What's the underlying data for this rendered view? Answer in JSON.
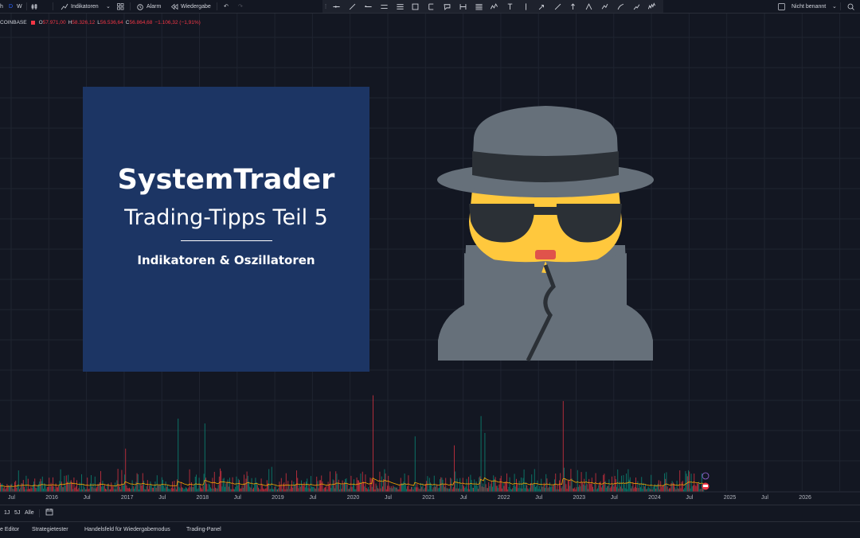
{
  "toolbar": {
    "interval_h": "h",
    "interval_d": "D",
    "interval_w": "W",
    "indicators_label": "Indikatoren",
    "alarm_label": "Alarm",
    "replay_label": "Wiedergabe",
    "layout_name": "Nicht benannt"
  },
  "drawing_tools": [
    "horizontal-line-icon",
    "trend-line-icon",
    "ray-icon",
    "parallel-channel-icon",
    "regression-channel-icon",
    "rectangle-icon",
    "date-range-icon",
    "callout-icon",
    "price-range-icon",
    "fib-retracement-icon",
    "path-icon",
    "text-icon",
    "vertical-line-icon",
    "long-position-icon",
    "arrow-marker-icon",
    "arrow-up-icon",
    "pitchfork-icon",
    "forecast-icon",
    "brush-icon",
    "projection-icon",
    "elliott-wave-icon"
  ],
  "legend": {
    "symbol": "COINBASE",
    "o_label": "O",
    "o_value": "57.971,00",
    "h_label": "H",
    "h_value": "58.326,12",
    "l_label": "L",
    "l_value": "56.536,64",
    "c_label": "C",
    "c_value": "56.864,68",
    "change": "−1.106,32 (−1,91%)"
  },
  "card": {
    "title": "SystemTrader",
    "subtitle": "Trading-Tipps Teil 5",
    "topic": "Indikatoren & Oszillatoren"
  },
  "xaxis": [
    "Jul",
    "2016",
    "Jul",
    "2017",
    "Jul",
    "2018",
    "Jul",
    "2019",
    "Jul",
    "2020",
    "Jul",
    "2021",
    "Jul",
    "2022",
    "Jul",
    "2023",
    "Jul",
    "2024",
    "Jul",
    "2025",
    "Jul",
    "2026"
  ],
  "range": {
    "r1": "1J",
    "r2": "5J",
    "r3": "Alle"
  },
  "bottom_tabs": [
    "e Editor",
    "Strategietester",
    "Handelsfeld für Wiedergabemodus",
    "Trading-Panel"
  ],
  "colors": {
    "background": "#131722",
    "card": "#1c3564",
    "down": "#f23645",
    "up": "#089981",
    "ma": "#f7a600",
    "hat": "#66707a",
    "face": "#ffc83d"
  }
}
